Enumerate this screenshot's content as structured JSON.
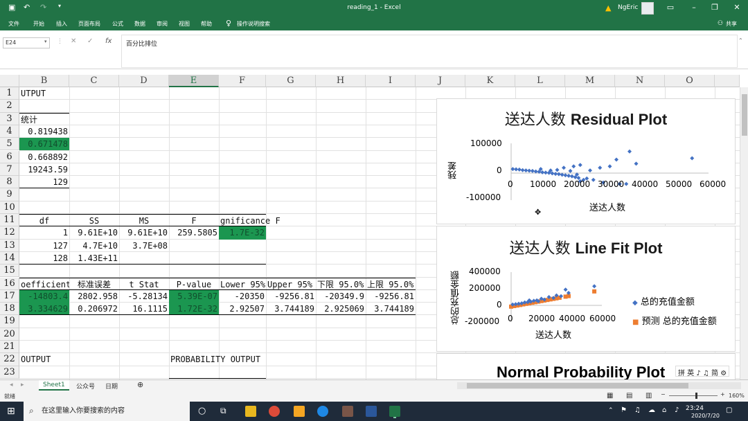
{
  "window": {
    "title": "reading_1 - Excel",
    "user": "NgEric",
    "share": "共享"
  },
  "ribbon": {
    "tabs": [
      "文件",
      "开始",
      "插入",
      "页面布局",
      "公式",
      "数据",
      "审阅",
      "视图",
      "帮助"
    ],
    "tell_me": "操作说明搜索"
  },
  "formula_bar": {
    "name_box": "E24",
    "content": "百分比排位",
    "fx": "fx"
  },
  "columns": [
    "B",
    "C",
    "D",
    "E",
    "F",
    "G",
    "H",
    "I",
    "J",
    "K",
    "L",
    "M",
    "N",
    "O"
  ],
  "rows": [
    "1",
    "2",
    "3",
    "4",
    "5",
    "6",
    "7",
    "8",
    "9",
    "10",
    "11",
    "12",
    "13",
    "14",
    "15",
    "16",
    "17",
    "18",
    "19",
    "20",
    "21",
    "22",
    "23"
  ],
  "cells": {
    "b1": "UTPUT",
    "b3": "统计",
    "b4": "0.819438",
    "b5": "0.671478",
    "b6": "0.668892",
    "b7": "19243.59",
    "b8": "129",
    "b11": "df",
    "c11": "SS",
    "d11": "MS",
    "e11": "F",
    "f11": "gnificance F",
    "b12": "1",
    "c12": "9.61E+10",
    "d12": "9.61E+10",
    "e12": "259.5805",
    "f12": "1.7E-32",
    "b13": "127",
    "c13": "4.7E+10",
    "d13": "3.7E+08",
    "b14": "128",
    "c14": "1.43E+11",
    "b16": "oefficient",
    "c16": "标准误差",
    "d16": "t Stat",
    "e16": "P-value",
    "f16": "Lower 95%",
    "g16": "Upper 95%",
    "h16": "下限 95.0%",
    "i16": "上限 95.0%",
    "b17": "-14803.4",
    "c17": "2802.958",
    "d17": "-5.28134",
    "e17": "5.39E-07",
    "f17": "-20350",
    "g17": "-9256.81",
    "h17": "-20349.9",
    "i17": "-9256.81",
    "b18": "3.334629",
    "c18": "0.206972",
    "d18": "16.1115",
    "e18": "1.72E-32",
    "f18": "2.92507",
    "g18": "3.744189",
    "h18": "2.925069",
    "i18": "3.744189",
    "b22": "OUTPUT",
    "e22": "PROBABILITY OUTPUT"
  },
  "charts": {
    "residual": {
      "title_cn": "送达人数",
      "title_en": "Residual Plot",
      "ylabel": "残差",
      "xlabel": "送达人数",
      "yticks": [
        "100000",
        "0",
        "-100000"
      ],
      "xticks": [
        "0",
        "10000",
        "20000",
        "30000",
        "40000",
        "50000",
        "60000"
      ]
    },
    "linefit": {
      "title_cn": "送达人数",
      "title_en": "Line Fit  Plot",
      "ylabel": "总的充值金额",
      "xlabel": "送达人数",
      "yticks": [
        "400000",
        "200000",
        "0",
        "-200000"
      ],
      "xticks": [
        "0",
        "20000",
        "40000",
        "60000"
      ],
      "legend": [
        "总的充值金额",
        "预测 总的充值金额"
      ]
    },
    "normal": {
      "title": "Normal Probability Plot"
    }
  },
  "chart_data": [
    {
      "type": "scatter",
      "xlim": [
        0,
        60000
      ],
      "ylim": [
        -100000,
        100000
      ],
      "points": [
        [
          500,
          15000
        ],
        [
          1500,
          14000
        ],
        [
          2500,
          13000
        ],
        [
          3500,
          11000
        ],
        [
          4500,
          10000
        ],
        [
          5500,
          9000
        ],
        [
          6500,
          8000
        ],
        [
          7500,
          6000
        ],
        [
          8500,
          5000
        ],
        [
          9500,
          3000
        ],
        [
          10500,
          2000
        ],
        [
          11500,
          1000
        ],
        [
          12500,
          -1000
        ],
        [
          13500,
          -3000
        ],
        [
          14500,
          -4000
        ],
        [
          15500,
          -6000
        ],
        [
          16500,
          -8000
        ],
        [
          17500,
          -10000
        ],
        [
          18500,
          -12000
        ],
        [
          19500,
          -15000
        ],
        [
          20500,
          -18000
        ],
        [
          22000,
          -25000
        ],
        [
          9000,
          15000
        ],
        [
          12000,
          10000
        ],
        [
          14000,
          12000
        ],
        [
          16000,
          20000
        ],
        [
          18000,
          8000
        ],
        [
          20000,
          -5000
        ],
        [
          21000,
          -30000
        ],
        [
          23000,
          -20000
        ],
        [
          24000,
          10000
        ],
        [
          25000,
          -25000
        ],
        [
          27000,
          20000
        ],
        [
          28000,
          -35000
        ],
        [
          30000,
          25000
        ],
        [
          32000,
          50000
        ],
        [
          33000,
          -40000
        ],
        [
          35000,
          -40000
        ],
        [
          36000,
          80000
        ],
        [
          38000,
          35000
        ],
        [
          55000,
          55000
        ],
        [
          21000,
          30000
        ],
        [
          19000,
          25000
        ]
      ]
    },
    {
      "type": "scatter",
      "xlim": [
        0,
        60000
      ],
      "ylim": [
        -200000,
        400000
      ],
      "series": [
        {
          "name": "总的充值金额",
          "color": "#4472c4",
          "points": [
            [
              1000,
              10000
            ],
            [
              3000,
              15000
            ],
            [
              5000,
              20000
            ],
            [
              7000,
              25000
            ],
            [
              9000,
              35000
            ],
            [
              11000,
              40000
            ],
            [
              13000,
              45000
            ],
            [
              15000,
              55000
            ],
            [
              17000,
              60000
            ],
            [
              20000,
              80000
            ],
            [
              22000,
              70000
            ],
            [
              25000,
              100000
            ],
            [
              30000,
              120000
            ],
            [
              33000,
              110000
            ],
            [
              36000,
              190000
            ],
            [
              38000,
              150000
            ],
            [
              55000,
              230000
            ],
            [
              28000,
              90000
            ],
            [
              12000,
              60000
            ],
            [
              18000,
              50000
            ]
          ]
        },
        {
          "name": "预测 总的充值金额",
          "color": "#ed7d31",
          "points": [
            [
              0,
              -15000
            ],
            [
              2000,
              -8000
            ],
            [
              4000,
              -1500
            ],
            [
              6000,
              5000
            ],
            [
              8000,
              12000
            ],
            [
              10000,
              18500
            ],
            [
              12000,
              25000
            ],
            [
              14000,
              32000
            ],
            [
              16000,
              38500
            ],
            [
              18000,
              45000
            ],
            [
              20000,
              52000
            ],
            [
              22000,
              58500
            ],
            [
              24000,
              65000
            ],
            [
              26000,
              72000
            ],
            [
              28000,
              78500
            ],
            [
              30000,
              85000
            ],
            [
              32000,
              92000
            ],
            [
              36000,
              105000
            ],
            [
              38000,
              112000
            ],
            [
              55000,
              168000
            ]
          ]
        }
      ]
    }
  ],
  "status": {
    "ready": "就绪",
    "zoom": "160%"
  },
  "sheets": [
    "Sheet1",
    "公众号",
    "日期"
  ],
  "taskbar": {
    "search": "在这里输入你要搜索的内容",
    "time": "23:24",
    "date": "2020/7/20"
  },
  "ime": "拼 英 ♪ ♫ 简 ⚙",
  "colors": {
    "excel_green": "#217346",
    "highlight": "#1b9650",
    "blue": "#4472c4",
    "orange": "#ed7d31"
  }
}
